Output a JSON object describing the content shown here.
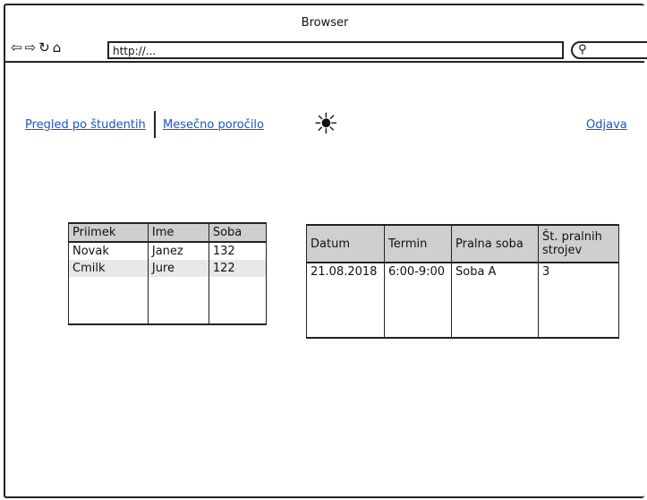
{
  "browser": {
    "title": "Browser",
    "url": "http://...",
    "nav_icons": [
      "back-icon",
      "forward-icon",
      "reload-icon",
      "home-icon"
    ],
    "search_icon": "search-icon"
  },
  "nav": {
    "link1": "Pregled po študentih",
    "link2": "Mesečno poročilo",
    "logout": "Odjava"
  },
  "students_table": {
    "headers": [
      "Priimek",
      "Ime",
      "Soba"
    ],
    "rows": [
      [
        "Novak",
        "Janez",
        "132"
      ],
      [
        "Cmilk",
        "Jure",
        "122"
      ]
    ]
  },
  "booking_table": {
    "headers": [
      "Datum",
      "Termin",
      "Pralna soba",
      "Št. pralnih strojev"
    ],
    "rows": [
      [
        "21.08.2018",
        "6:00-9:00",
        "Soba A",
        "3"
      ]
    ]
  },
  "colors": {
    "link": "#1a55c8",
    "header_bg": "#cfcfcf"
  }
}
